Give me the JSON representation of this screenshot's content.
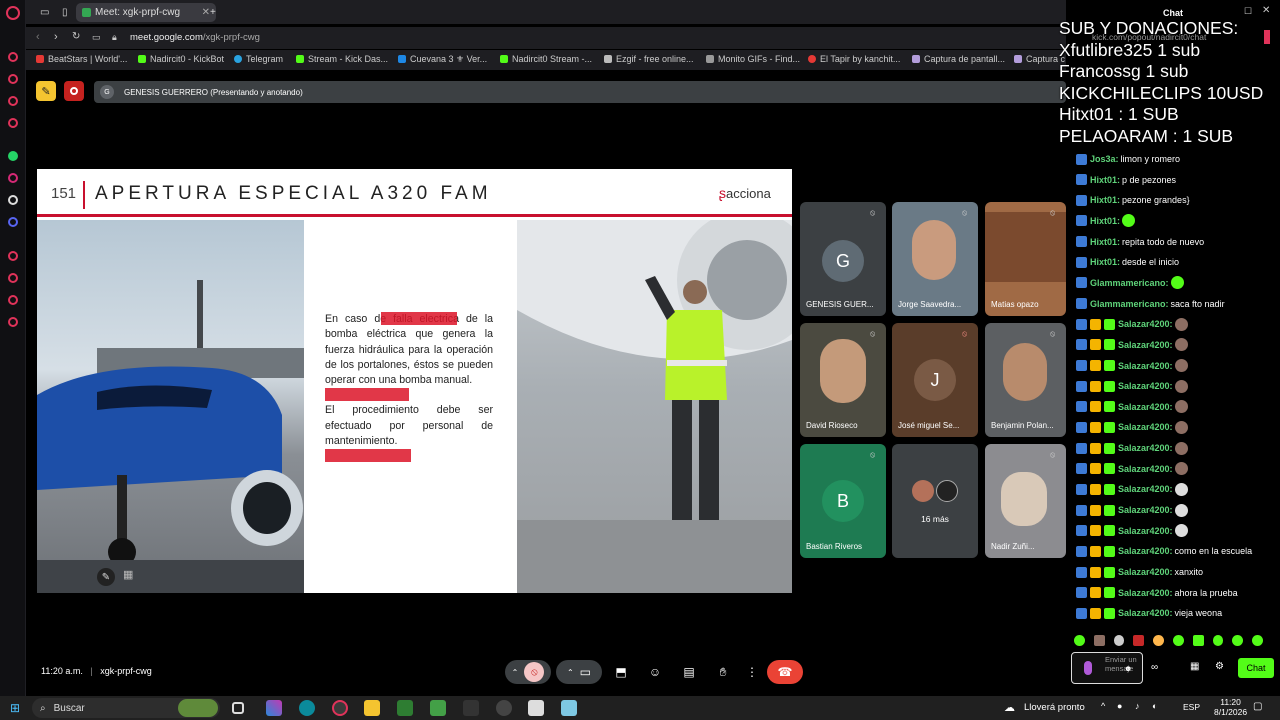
{
  "browser": {
    "tab_title": "Meet: xgk-prpf-cwg",
    "url_host": "meet.google.com",
    "url_path": "/xgk-prpf-cwg",
    "bookmarks": [
      "BeatStars | World'...",
      "Nadircit0 - KickBot",
      "Telegram",
      "Stream - Kick Das...",
      "Cuevana 3 ⚜ Ver...",
      "Nadircit0 Stream -...",
      "Ezgif - free online...",
      "Monito GIFs - Find...",
      "El Tapir by kanchit...",
      "Captura de pantall...",
      "Captura c"
    ]
  },
  "meet": {
    "presenter": "GENESIS GUERRERO (Presentando y anotando)",
    "presenter_initial": "G",
    "time": "11:20 a.m.",
    "meeting_code": "xgk-prpf-cwg",
    "participants": [
      {
        "name": "GENESIS GUER...",
        "initial": "G",
        "color": "#4a5560"
      },
      {
        "name": "Jorge Saavedra...",
        "initial": "",
        "color": "#6a7a86"
      },
      {
        "name": "Matias opazo",
        "initial": "",
        "color": "#a06a45"
      },
      {
        "name": "David Rioseco",
        "initial": "",
        "color": "#4b4a40"
      },
      {
        "name": "José miguel Se...",
        "initial": "J",
        "color": "#5a3d2a"
      },
      {
        "name": "Benjamin Polan...",
        "initial": "",
        "color": "#5c5f62"
      },
      {
        "name": "Bastian Riveros",
        "initial": "B",
        "color": "#1e7b52"
      },
      {
        "name": "16 más",
        "initial": "",
        "color": "#3c4043"
      },
      {
        "name": "Nadir Zuñi...",
        "initial": "",
        "color": "#8c8c90"
      }
    ]
  },
  "slide": {
    "number": "151",
    "title": "APERTURA ESPECIAL A320 FAM",
    "brand": "acciona",
    "paragraph1": "En caso de falla electrica de la bomba eléctrica que genera la fuerza hidráulica para la operación de los portalones, éstos se pueden operar con una bomba manual.",
    "paragraph2": "El procedimiento debe ser efectuado por personal de mantenimiento."
  },
  "overlay": {
    "lines": [
      "SUB Y DONACIONES:",
      "Xfutlibre325 1 sub",
      "Francossg 1 sub",
      "KICKCHILECLIPS 10USD",
      "Hitxt01 : 1 SUB",
      "PELAOARAM : 1 SUB"
    ]
  },
  "chat": {
    "header": "Chat",
    "url": "kick.com/popout/nadircit0/chat",
    "messages": [
      {
        "user": "Jos3a:",
        "text": "limon y romero"
      },
      {
        "user": "Hixt01:",
        "text": "p de pezones"
      },
      {
        "user": "Hixt01:",
        "text": "pezone grandes}"
      },
      {
        "user": "Hixt01:",
        "text": ""
      },
      {
        "user": "Hixt01:",
        "text": "repita todo de nuevo"
      },
      {
        "user": "Hixt01:",
        "text": "desde el inicio"
      },
      {
        "user": "Glammamericano:",
        "text": ""
      },
      {
        "user": "Glammamericano:",
        "text": "saca fto nadir"
      },
      {
        "user": "Salazar4200:",
        "text": ""
      },
      {
        "user": "Salazar4200:",
        "text": ""
      },
      {
        "user": "Salazar4200:",
        "text": ""
      },
      {
        "user": "Salazar4200:",
        "text": ""
      },
      {
        "user": "Salazar4200:",
        "text": ""
      },
      {
        "user": "Salazar4200:",
        "text": ""
      },
      {
        "user": "Salazar4200:",
        "text": ""
      },
      {
        "user": "Salazar4200:",
        "text": ""
      },
      {
        "user": "Salazar4200:",
        "text": ""
      },
      {
        "user": "Salazar4200:",
        "text": ""
      },
      {
        "user": "Salazar4200:",
        "text": ""
      },
      {
        "user": "Salazar4200:",
        "text": "como en la escuela"
      },
      {
        "user": "Salazar4200:",
        "text": "xanxito"
      },
      {
        "user": "Salazar4200:",
        "text": "ahora la prueba"
      },
      {
        "user": "Salazar4200:",
        "text": "vieja weona"
      }
    ],
    "input_placeholder": "Enviar un mensaje",
    "chat_button": "Chat"
  },
  "taskbar": {
    "search": "Buscar",
    "weather": "Lloverá pronto",
    "lang": "ESP",
    "time": "11:20",
    "date": "8/1/2026"
  }
}
